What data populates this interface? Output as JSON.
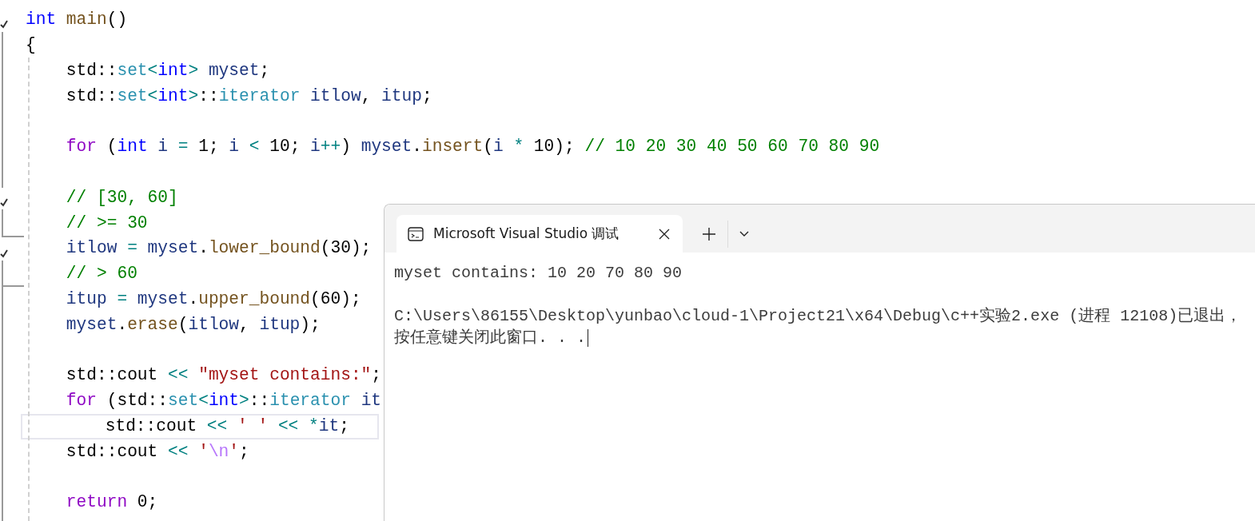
{
  "editor": {
    "lines": [
      {
        "kind": "code",
        "tokens": [
          {
            "kind": "keyword",
            "text": "int"
          },
          {
            "kind": "func",
            "text": " main"
          },
          {
            "kind": "plain",
            "text": "()"
          }
        ]
      },
      {
        "kind": "code",
        "tokens": [
          {
            "kind": "plain",
            "text": "{"
          }
        ]
      },
      {
        "kind": "code",
        "tokens": [
          {
            "kind": "plain",
            "text": "    std::"
          },
          {
            "kind": "type",
            "text": "set"
          },
          {
            "kind": "op",
            "text": "<"
          },
          {
            "kind": "keyword",
            "text": "int"
          },
          {
            "kind": "op",
            "text": ">"
          },
          {
            "kind": "var",
            "text": " myset"
          },
          {
            "kind": "plain",
            "text": ";"
          }
        ]
      },
      {
        "kind": "code",
        "tokens": [
          {
            "kind": "plain",
            "text": "    std::"
          },
          {
            "kind": "type",
            "text": "set"
          },
          {
            "kind": "op",
            "text": "<"
          },
          {
            "kind": "keyword",
            "text": "int"
          },
          {
            "kind": "op",
            "text": ">"
          },
          {
            "kind": "plain",
            "text": "::"
          },
          {
            "kind": "type",
            "text": "iterator"
          },
          {
            "kind": "var",
            "text": " itlow"
          },
          {
            "kind": "plain",
            "text": ", "
          },
          {
            "kind": "var",
            "text": "itup"
          },
          {
            "kind": "plain",
            "text": ";"
          }
        ]
      },
      {
        "kind": "blank"
      },
      {
        "kind": "code",
        "tokens": [
          {
            "kind": "control",
            "text": "    for"
          },
          {
            "kind": "plain",
            "text": " ("
          },
          {
            "kind": "keyword",
            "text": "int"
          },
          {
            "kind": "var",
            "text": " i"
          },
          {
            "kind": "op",
            "text": " ="
          },
          {
            "kind": "plain",
            "text": " 1; "
          },
          {
            "kind": "var",
            "text": "i"
          },
          {
            "kind": "op",
            "text": " <"
          },
          {
            "kind": "plain",
            "text": " 10; "
          },
          {
            "kind": "var",
            "text": "i"
          },
          {
            "kind": "op",
            "text": "++"
          },
          {
            "kind": "plain",
            "text": ") "
          },
          {
            "kind": "var",
            "text": "myset"
          },
          {
            "kind": "plain",
            "text": "."
          },
          {
            "kind": "func",
            "text": "insert"
          },
          {
            "kind": "plain",
            "text": "("
          },
          {
            "kind": "var",
            "text": "i"
          },
          {
            "kind": "op",
            "text": " *"
          },
          {
            "kind": "plain",
            "text": " 10); "
          },
          {
            "kind": "comment",
            "text": "// 10 20 30 40 50 60 70 80 90"
          }
        ]
      },
      {
        "kind": "blank"
      },
      {
        "kind": "code",
        "tokens": [
          {
            "kind": "comment",
            "text": "    // [30, 60]"
          }
        ]
      },
      {
        "kind": "code",
        "tokens": [
          {
            "kind": "comment",
            "text": "    // >= 30"
          }
        ]
      },
      {
        "kind": "code",
        "tokens": [
          {
            "kind": "var",
            "text": "    itlow"
          },
          {
            "kind": "op",
            "text": " ="
          },
          {
            "kind": "var",
            "text": " myset"
          },
          {
            "kind": "plain",
            "text": "."
          },
          {
            "kind": "func",
            "text": "lower_bound"
          },
          {
            "kind": "plain",
            "text": "(30);"
          }
        ]
      },
      {
        "kind": "code",
        "tokens": [
          {
            "kind": "comment",
            "text": "    // > 60"
          }
        ]
      },
      {
        "kind": "code",
        "tokens": [
          {
            "kind": "var",
            "text": "    itup"
          },
          {
            "kind": "op",
            "text": " ="
          },
          {
            "kind": "var",
            "text": " myset"
          },
          {
            "kind": "plain",
            "text": "."
          },
          {
            "kind": "func",
            "text": "upper_bound"
          },
          {
            "kind": "plain",
            "text": "(60);"
          }
        ]
      },
      {
        "kind": "code",
        "tokens": [
          {
            "kind": "var",
            "text": "    myset"
          },
          {
            "kind": "plain",
            "text": "."
          },
          {
            "kind": "func",
            "text": "erase"
          },
          {
            "kind": "plain",
            "text": "("
          },
          {
            "kind": "var",
            "text": "itlow"
          },
          {
            "kind": "plain",
            "text": ", "
          },
          {
            "kind": "var",
            "text": "itup"
          },
          {
            "kind": "plain",
            "text": ");"
          }
        ]
      },
      {
        "kind": "blank"
      },
      {
        "kind": "code",
        "tokens": [
          {
            "kind": "plain",
            "text": "    std::cout"
          },
          {
            "kind": "op",
            "text": " <<"
          },
          {
            "kind": "string",
            "text": " \"myset contains:\""
          },
          {
            "kind": "plain",
            "text": ";"
          }
        ]
      },
      {
        "kind": "code",
        "tokens": [
          {
            "kind": "control",
            "text": "    for"
          },
          {
            "kind": "plain",
            "text": " (std::"
          },
          {
            "kind": "type",
            "text": "set"
          },
          {
            "kind": "op",
            "text": "<"
          },
          {
            "kind": "keyword",
            "text": "int"
          },
          {
            "kind": "op",
            "text": ">"
          },
          {
            "kind": "plain",
            "text": "::"
          },
          {
            "kind": "type",
            "text": "iterator"
          },
          {
            "kind": "var",
            "text": " it"
          }
        ]
      },
      {
        "kind": "code",
        "current": true,
        "tokens": [
          {
            "kind": "plain",
            "text": "        std::cout"
          },
          {
            "kind": "op",
            "text": " <<"
          },
          {
            "kind": "string",
            "text": " ' '"
          },
          {
            "kind": "op",
            "text": " <<"
          },
          {
            "kind": "op",
            "text": " *"
          },
          {
            "kind": "var",
            "text": "it"
          },
          {
            "kind": "plain",
            "text": ";"
          }
        ]
      },
      {
        "kind": "code",
        "tokens": [
          {
            "kind": "plain",
            "text": "    std::cout"
          },
          {
            "kind": "op",
            "text": " <<"
          },
          {
            "kind": "string",
            "text": " '"
          },
          {
            "kind": "escape",
            "text": "\\n"
          },
          {
            "kind": "string",
            "text": "'"
          },
          {
            "kind": "plain",
            "text": ";"
          }
        ]
      },
      {
        "kind": "blank"
      },
      {
        "kind": "code",
        "tokens": [
          {
            "kind": "control",
            "text": "    return"
          },
          {
            "kind": "plain",
            "text": " 0;"
          }
        ]
      }
    ]
  },
  "terminal": {
    "tabs": [
      {
        "title": "Microsoft Visual Studio 调试",
        "selected": true
      }
    ],
    "output": [
      {
        "kind": "text",
        "text": "myset contains: 10 20 70 80 90"
      },
      {
        "kind": "blank"
      },
      {
        "kind": "text",
        "text": "C:\\Users\\86155\\Desktop\\yunbao\\cloud-1\\Project21\\x64\\Debug\\c++实验2.exe (进程 12108)已退出，"
      },
      {
        "kind": "text",
        "text": "按任意键关闭此窗口. . ."
      }
    ]
  }
}
